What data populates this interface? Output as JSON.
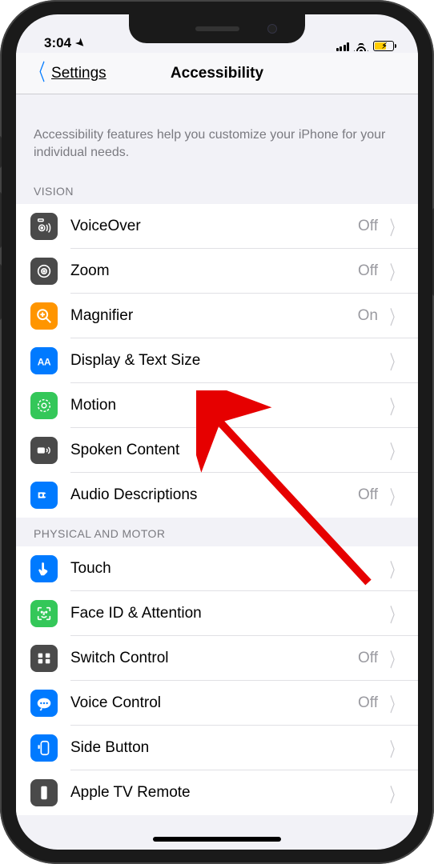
{
  "statusbar": {
    "time": "3:04"
  },
  "navbar": {
    "back_label": "Settings",
    "title": "Accessibility"
  },
  "description": "Accessibility features help you customize your iPhone for your individual needs.",
  "sections": [
    {
      "header": "VISION",
      "rows": [
        {
          "label": "VoiceOver",
          "value": "Off",
          "icon_bg": "#4a4a4a",
          "icon": "voiceover"
        },
        {
          "label": "Zoom",
          "value": "Off",
          "icon_bg": "#4a4a4a",
          "icon": "zoom"
        },
        {
          "label": "Magnifier",
          "value": "On",
          "icon_bg": "#ff9500",
          "icon": "magnifier"
        },
        {
          "label": "Display & Text Size",
          "value": "",
          "icon_bg": "#007aff",
          "icon": "textsize"
        },
        {
          "label": "Motion",
          "value": "",
          "icon_bg": "#34c759",
          "icon": "motion"
        },
        {
          "label": "Spoken Content",
          "value": "",
          "icon_bg": "#4a4a4a",
          "icon": "spoken"
        },
        {
          "label": "Audio Descriptions",
          "value": "Off",
          "icon_bg": "#007aff",
          "icon": "audiodesc"
        }
      ]
    },
    {
      "header": "PHYSICAL AND MOTOR",
      "rows": [
        {
          "label": "Touch",
          "value": "",
          "icon_bg": "#007aff",
          "icon": "touch"
        },
        {
          "label": "Face ID & Attention",
          "value": "",
          "icon_bg": "#34c759",
          "icon": "faceid"
        },
        {
          "label": "Switch Control",
          "value": "Off",
          "icon_bg": "#4a4a4a",
          "icon": "switch"
        },
        {
          "label": "Voice Control",
          "value": "Off",
          "icon_bg": "#007aff",
          "icon": "voicectl"
        },
        {
          "label": "Side Button",
          "value": "",
          "icon_bg": "#007aff",
          "icon": "sidebtn"
        },
        {
          "label": "Apple TV Remote",
          "value": "",
          "icon_bg": "#4a4a4a",
          "icon": "atv"
        }
      ]
    }
  ],
  "annotation_arrow": {
    "points_to": "Display & Text Size"
  }
}
